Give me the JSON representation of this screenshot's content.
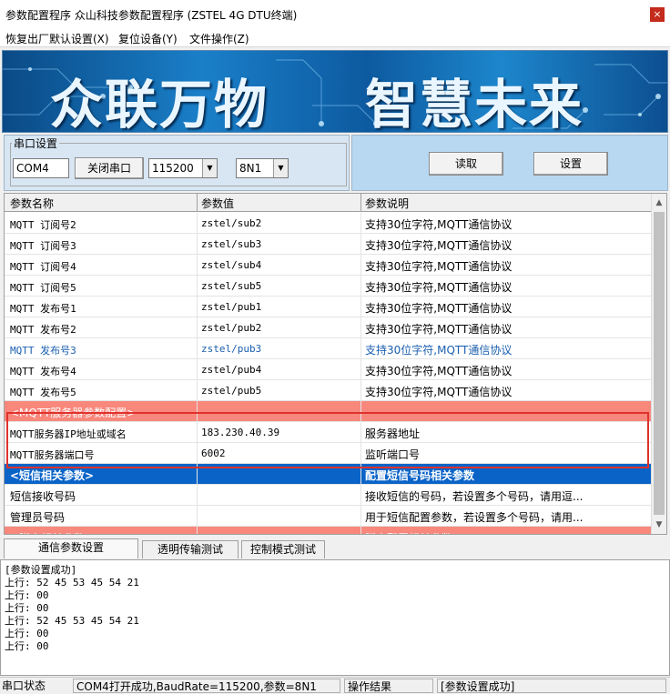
{
  "window": {
    "title": "参数配置程序  众山科技参数配置程序 (ZSTEL 4G DTU终端)",
    "close": "×"
  },
  "menu": [
    "恢复出厂默认设置(X)",
    "复位设备(Y)",
    "文件操作(Z)"
  ],
  "banner": {
    "text_left": "众联万物",
    "text_right": "智慧未来"
  },
  "serial": {
    "legend": "串口设置",
    "port": "COM4",
    "close_button": "关闭串口",
    "baud": "115200",
    "format": "8N1"
  },
  "actions": {
    "read": "读取",
    "set": "设置"
  },
  "grid": {
    "columns": [
      "参数名称",
      "参数值",
      "参数说明"
    ],
    "rows": [
      {
        "name": "MQTT 订阅号2",
        "value": "zstel/sub2",
        "desc": "支持30位字符,MQTT通信协议",
        "style": "mono"
      },
      {
        "name": "MQTT 订阅号3",
        "value": "zstel/sub3",
        "desc": "支持30位字符,MQTT通信协议",
        "style": "mono"
      },
      {
        "name": "MQTT 订阅号4",
        "value": "zstel/sub4",
        "desc": "支持30位字符,MQTT通信协议",
        "style": "mono"
      },
      {
        "name": "MQTT 订阅号5",
        "value": "zstel/sub5",
        "desc": "支持30位字符,MQTT通信协议",
        "style": "mono"
      },
      {
        "name": "MQTT 发布号1",
        "value": "zstel/pub1",
        "desc": "支持30位字符,MQTT通信协议",
        "style": "mono"
      },
      {
        "name": "MQTT 发布号2",
        "value": "zstel/pub2",
        "desc": "支持30位字符,MQTT通信协议",
        "style": "mono"
      },
      {
        "name": "MQTT 发布号3",
        "value": "zstel/pub3",
        "desc": "支持30位字符,MQTT通信协议",
        "style": "mono blue"
      },
      {
        "name": "MQTT 发布号4",
        "value": "zstel/pub4",
        "desc": "支持30位字符,MQTT通信协议",
        "style": "mono"
      },
      {
        "name": "MQTT 发布号5",
        "value": "zstel/pub5",
        "desc": "支持30位字符,MQTT通信协议",
        "style": "mono"
      },
      {
        "name": "<MQTT服务器参数配置>",
        "value": "",
        "desc": "",
        "style": "salmon"
      },
      {
        "name": "MQTT服务器IP地址或域名",
        "value": "183.230.40.39",
        "desc": "服务器地址",
        "style": "mono"
      },
      {
        "name": "MQTT服务器端口号",
        "value": "6002",
        "desc": "监听端口号",
        "style": "mono"
      },
      {
        "name": "<短信相关参数>",
        "value": "",
        "desc": "配置短信号码相关参数",
        "style": "selected"
      },
      {
        "name": "短信接收号码",
        "value": "",
        "desc": "接收短信的号码，若设置多个号码，请用逗...",
        "style": ""
      },
      {
        "name": " 管理员号码",
        "value": "",
        "desc": "用于短信配置参数，若设置多个号码，请用...",
        "style": ""
      },
      {
        "name": "<脚本相关参数>",
        "value": "",
        "desc": "脚本配置相关参数",
        "style": "salmon"
      }
    ]
  },
  "tabs": [
    "通信参数设置",
    "透明传输测试",
    "控制模式测试"
  ],
  "log": [
    "[参数设置成功]",
    "上行: 52 45 53 45 54 21",
    "上行: 00",
    "上行: 00",
    "上行: 52 45 53 45 54 21",
    "上行: 00",
    "上行: 00"
  ],
  "status": {
    "label": "串口状态",
    "value": "COM4打开成功,BaudRate=115200,参数=8N1",
    "result_label": "操作结果",
    "result_value": "[参数设置成功]"
  }
}
